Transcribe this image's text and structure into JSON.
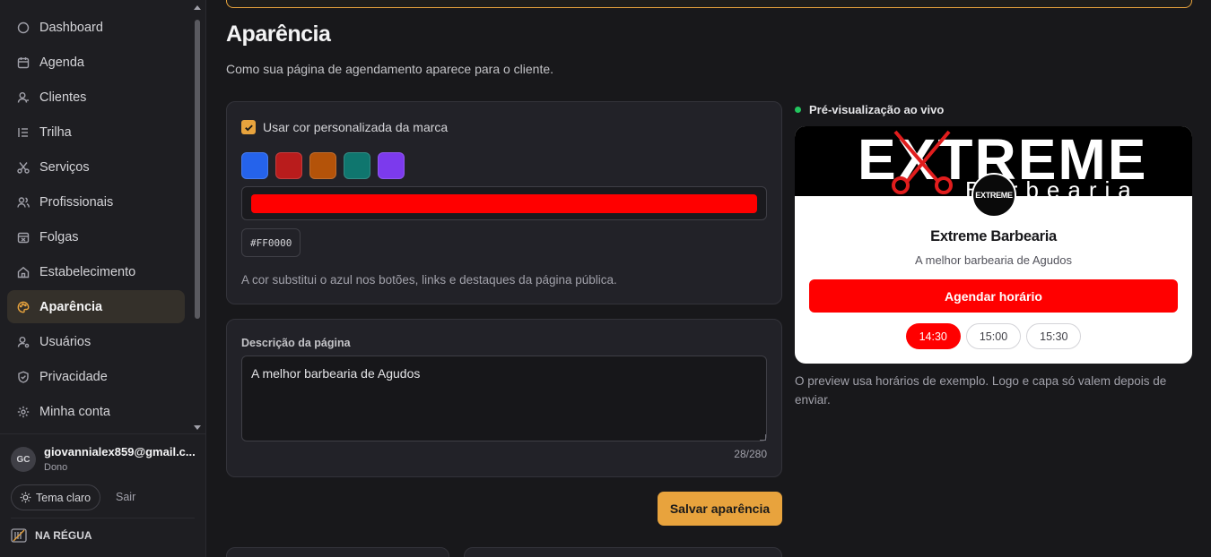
{
  "sidebar": {
    "items": [
      {
        "label": "Dashboard",
        "icon": "circle-icon"
      },
      {
        "label": "Agenda",
        "icon": "calendar-icon"
      },
      {
        "label": "Clientes",
        "icon": "user-icon"
      },
      {
        "label": "Trilha",
        "icon": "list-icon"
      },
      {
        "label": "Serviços",
        "icon": "scissors-icon"
      },
      {
        "label": "Profissionais",
        "icon": "users-icon"
      },
      {
        "label": "Folgas",
        "icon": "calendar-off-icon"
      },
      {
        "label": "Estabelecimento",
        "icon": "home-icon"
      },
      {
        "label": "Aparência",
        "icon": "palette-icon",
        "active": true
      },
      {
        "label": "Usuários",
        "icon": "user-cog-icon"
      },
      {
        "label": "Privacidade",
        "icon": "shield-icon"
      },
      {
        "label": "Minha conta",
        "icon": "settings-icon"
      }
    ],
    "user": {
      "initials": "GC",
      "email": "giovannialex859@gmail.c...",
      "role": "Dono"
    },
    "theme_label": "Tema claro",
    "logout_label": "Sair",
    "brand": "NA RÉGUA"
  },
  "page": {
    "title": "Aparência",
    "subtitle": "Como sua página de agendamento aparece para o cliente."
  },
  "color_card": {
    "checkbox_label": "Usar cor personalizada da marca",
    "checked": true,
    "swatches": [
      "#2563eb",
      "#b91c1c",
      "#b45309",
      "#0f766e",
      "#7c3aed"
    ],
    "selected_color": "#FF0000",
    "help": "A cor substitui o azul nos botões, links e destaques da página pública."
  },
  "desc_card": {
    "label": "Descrição da página",
    "value": "A melhor barbearia de Agudos",
    "counter": "28/280"
  },
  "save_label": "Salvar aparência",
  "preview": {
    "header": "Pré-visualização ao vivo",
    "cover_text": "EXTREME",
    "cover_sub": "Barbearia",
    "logo_text": "EXTREME",
    "shop_name": "Extreme Barbearia",
    "tagline": "A melhor barbearia de Agudos",
    "book_label": "Agendar horário",
    "slots": [
      "14:30",
      "15:00",
      "15:30"
    ],
    "selected_slot": 0,
    "note": "O preview usa horários de exemplo. Logo e capa só valem depois de enviar."
  },
  "colors": {
    "accent": "#e8a33d",
    "brand_red": "#FF0000",
    "live": "#22c55e"
  }
}
